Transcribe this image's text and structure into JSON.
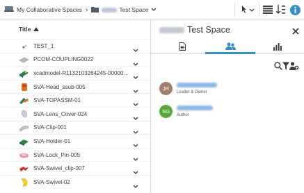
{
  "colors": {
    "accent": "#368ec4",
    "info": "#368ec4",
    "text": "#3d3d3d",
    "border": "#d6d8da"
  },
  "breadcrumb": {
    "space": {
      "label": "My Collaborative Spaces",
      "icon": "collab-spaces-icon"
    },
    "separator": "›",
    "current": {
      "label": "Test Space",
      "icon": "folder-icon"
    }
  },
  "list": {
    "column_title": "Title",
    "rows": [
      {
        "name": "TEST_1",
        "thumb": "dot"
      },
      {
        "name": "PCOM-COUPLING0022",
        "thumb": "plate"
      },
      {
        "name": "xcadmodel-R1132103264245-000001…",
        "thumb": "green-block"
      },
      {
        "name": "SVA-Head_ssub-005",
        "thumb": "orange-block"
      },
      {
        "name": "SVA-TOPASSM-01",
        "thumb": "green-orange"
      },
      {
        "name": "SVA-Lens_Cover-024",
        "thumb": "lens"
      },
      {
        "name": "SVA-Clip-001",
        "thumb": "clip"
      },
      {
        "name": "SVA-Holder-01",
        "thumb": "holder"
      },
      {
        "name": "SVA-Lock_Pin-005",
        "thumb": "pin"
      },
      {
        "name": "SVA-Swivel_clip-007",
        "thumb": "red-swivel"
      },
      {
        "name": "SVA-Swivel-02",
        "thumb": "yellow-swivel"
      }
    ]
  },
  "side": {
    "title": "Test Space",
    "tabs": [
      {
        "name": "tab-properties",
        "icon": "document-icon"
      },
      {
        "name": "tab-members",
        "icon": "members-icon",
        "active": true
      },
      {
        "name": "tab-analytics",
        "icon": "bar-chart-icon"
      }
    ],
    "members": [
      {
        "initials": "JR",
        "role": "Leader & Owner",
        "color": "#a47e6a"
      },
      {
        "initials": "SG",
        "role": "Author",
        "color": "#5aa83c"
      }
    ]
  }
}
